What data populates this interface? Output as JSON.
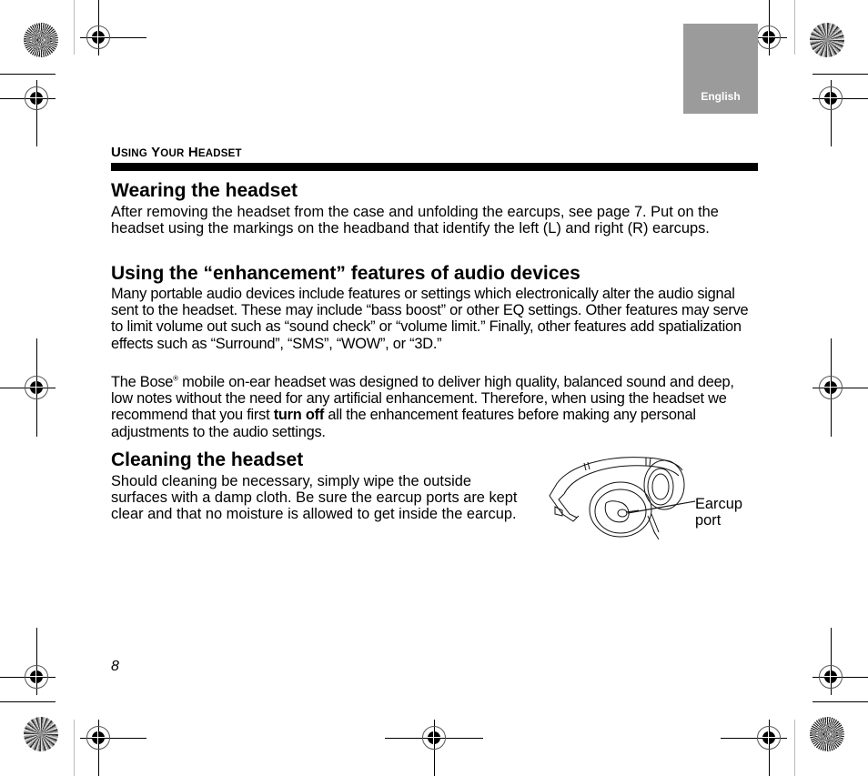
{
  "language_tab": "English",
  "section_header": {
    "first_initial": "U",
    "first_rest": "SING",
    "second_initial": "Y",
    "second_rest": "OUR",
    "third_initial": "H",
    "third_rest": "EADSET"
  },
  "sections": {
    "wearing": {
      "heading": "Wearing the headset",
      "body": "After removing the headset from the case and unfolding the earcups, see page 7. Put on the headset using the markings on the headband that identify the left (L) and right (R) earcups."
    },
    "enhancement": {
      "heading": "Using the “enhancement” features of audio devices",
      "body1": "Many portable audio devices include features or settings which electronically alter the audio signal sent to the headset. These may include “bass boost” or other EQ settings. Other features may serve to limit volume out such as “sound check” or “volume limit.” Finally, other features add spatialization effects such as “Surround”, “SMS”, “WOW”, or “3D.”",
      "body2_pre": "The Bose",
      "body2_reg": "®",
      "body2_mid": " mobile on-ear headset was designed to deliver high quality, balanced sound and deep, low notes without the need for any artificial enhancement. Therefore, when using the headset we recommend that you first ",
      "body2_bold": "turn off",
      "body2_post": " all the enhancement features before making any personal adjustments to the audio settings."
    },
    "cleaning": {
      "heading": "Cleaning the headset",
      "body": "Should cleaning be necessary, simply wipe the outside surfaces with a damp cloth. Be sure the earcup ports are kept clear and that no moisture is allowed to get inside the earcup."
    }
  },
  "illustration": {
    "description": "headset-line-drawing",
    "callout_line1": "Earcup",
    "callout_line2": "port"
  },
  "page_number": "8"
}
